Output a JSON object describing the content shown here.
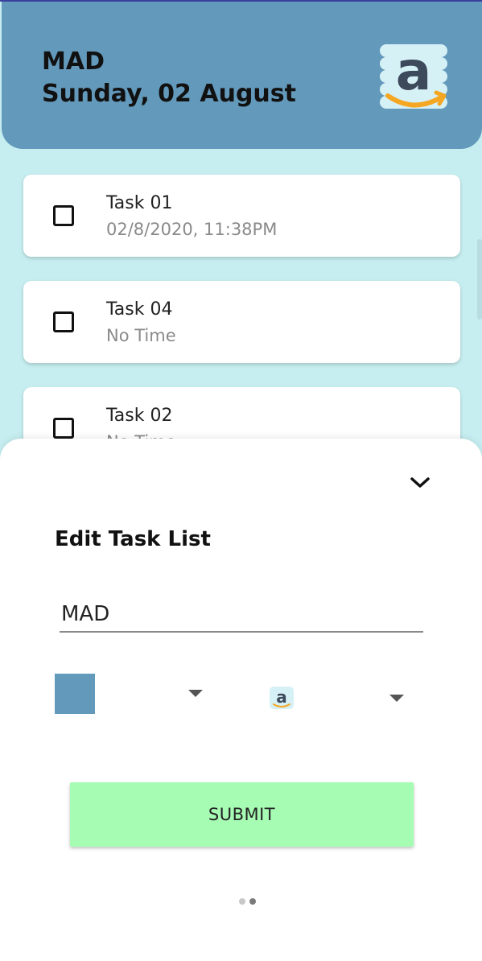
{
  "header": {
    "title": "MAD",
    "date": "Sunday, 02 August",
    "background_color": "#6399bb",
    "logo_icon": "amazon-logo-icon"
  },
  "tasks": [
    {
      "name": "Task 01",
      "time": "02/8/2020, 11:38PM",
      "checked": false
    },
    {
      "name": "Task 04",
      "time": "No Time",
      "checked": false
    },
    {
      "name": "Task 02",
      "time": "No Time",
      "checked": false
    }
  ],
  "edit_sheet": {
    "collapse_icon": "chevron-down-icon",
    "title": "Edit Task List",
    "name_input_value": "MAD",
    "selected_color": "#6399bb",
    "selected_icon": "amazon-logo-icon",
    "submit_label": "SUBMIT",
    "submit_color": "#a7fcb4",
    "page_indicator": {
      "count": 2,
      "active_index": 1
    }
  },
  "colors": {
    "background": "#c6eef0",
    "card": "#ffffff",
    "sheet": "#ffffff"
  }
}
